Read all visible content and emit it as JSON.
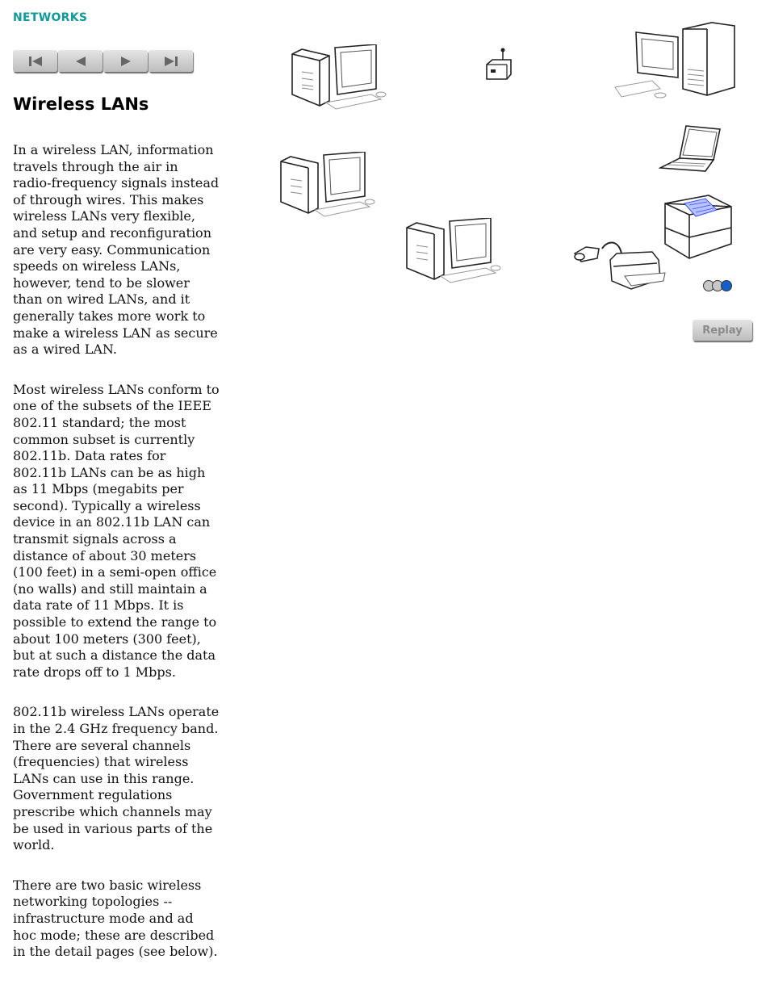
{
  "header": {
    "section": "NETWORKS"
  },
  "nav": {
    "buttons": [
      {
        "name": "first",
        "icon": "skip-to-first-icon"
      },
      {
        "name": "previous",
        "icon": "previous-icon"
      },
      {
        "name": "next",
        "icon": "next-icon"
      },
      {
        "name": "last",
        "icon": "skip-to-last-icon"
      }
    ]
  },
  "page": {
    "title": "Wireless LANs",
    "paragraphs": [
      "In a wireless LAN, information travels through the air in radio-frequency signals instead of through wires. This makes wireless LANs very flexible, and setup and reconfiguration are very easy. Communication speeds on wireless LANs, however, tend to be slower than on wired LANs, and it generally takes more work to make a wireless LAN as secure as a wired LAN.",
      "Most wireless LANs conform to one of the subsets of the IEEE 802.11 standard; the most common subset is currently 802.11b. Data rates for 802.11b LANs can be as high as 11 Mbps (megabits per second). Typically a wireless device in an 802.11b LAN can transmit signals across a distance of about 30 meters (100 feet) in a semi-open office (no walls) and still maintain a data rate of 11 Mbps. It is possible to extend the range to about 100 meters (300 feet), but at such a distance the data rate drops off to 1 Mbps.",
      "802.11b wireless LANs operate in the 2.4 GHz frequency band. There are several channels (frequencies) that wireless LANs can use in this range. Government regulations prescribe which channels may be used in various parts of the world.",
      "There are two basic wireless networking topologies -- infrastructure mode and ad hoc mode; these are described in the detail pages (see below)."
    ]
  },
  "animation": {
    "devices": [
      "desktop-computer",
      "wireless-access-point",
      "tower-computer",
      "laptop",
      "desktop-computer",
      "desktop-computer",
      "laser-printer",
      "inkjet-printer-with-wireless-adapter"
    ],
    "steps_total": 3,
    "current_step": 3,
    "dot_colors": {
      "inactive": "#c8c8c8",
      "active": "#1560c8"
    },
    "replay_label": "Replay"
  }
}
